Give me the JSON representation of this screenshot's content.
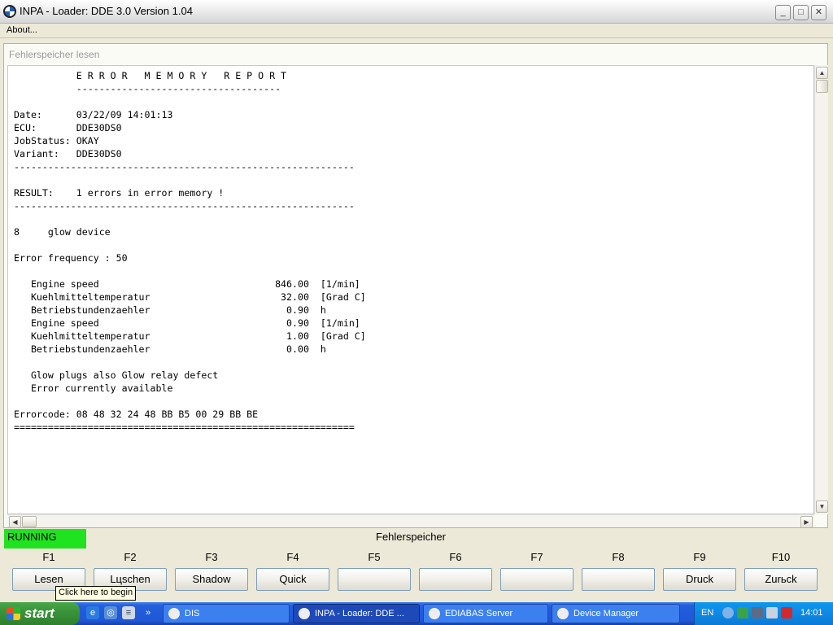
{
  "window": {
    "title": "INPA - Loader:  DDE 3.0 Version 1.04"
  },
  "menu": {
    "about": "About..."
  },
  "panel": {
    "title": "Fehlerspeicher lesen"
  },
  "report": {
    "lines": [
      "           E R R O R   M E M O R Y   R E P O R T",
      "           ------------------------------------",
      "",
      "Date:      03/22/09 14:01:13",
      "ECU:       DDE30DS0",
      "JobStatus: OKAY",
      "Variant:   DDE30DS0",
      "------------------------------------------------------------",
      "",
      "RESULT:    1 errors in error memory !",
      "------------------------------------------------------------",
      "",
      "8     glow device",
      "",
      "Error frequency : 50",
      "",
      "   Engine speed                               846.00  [1/min]",
      "   Kuehlmitteltemperatur                       32.00  [Grad C]",
      "   Betriebstundenzaehler                        0.90  h",
      "   Engine speed                                 0.90  [1/min]",
      "   Kuehlmitteltemperatur                        1.00  [Grad C]",
      "   Betriebstundenzaehler                        0.00  h",
      "",
      "   Glow plugs also Glow relay defect",
      "   Error currently available",
      "",
      "Errorcode: 08 48 32 24 48 BB B5 00 29 BB BE",
      "============================================================"
    ]
  },
  "status": {
    "state": "RUNNING",
    "title": "Fehlerspeicher",
    "state_color": "#1fe31f"
  },
  "fkeys": [
    {
      "key": "F1",
      "label": "Lesen"
    },
    {
      "key": "F2",
      "label": "Lцschen"
    },
    {
      "key": "F3",
      "label": "Shadow"
    },
    {
      "key": "F4",
      "label": "Quick"
    },
    {
      "key": "F5",
      "label": ""
    },
    {
      "key": "F6",
      "label": ""
    },
    {
      "key": "F7",
      "label": ""
    },
    {
      "key": "F8",
      "label": ""
    },
    {
      "key": "F9",
      "label": "Druck"
    },
    {
      "key": "F10",
      "label": "Zurьck"
    }
  ],
  "tooltip": "Click here to begin",
  "taskbar": {
    "start": "start",
    "tasks": [
      {
        "label": "DIS",
        "active": false
      },
      {
        "label": "INPA - Loader:  DDE ...",
        "active": true
      },
      {
        "label": "EDIABAS Server",
        "active": false
      },
      {
        "label": "Device Manager",
        "active": false
      }
    ],
    "language": "EN",
    "clock": "14:01"
  }
}
